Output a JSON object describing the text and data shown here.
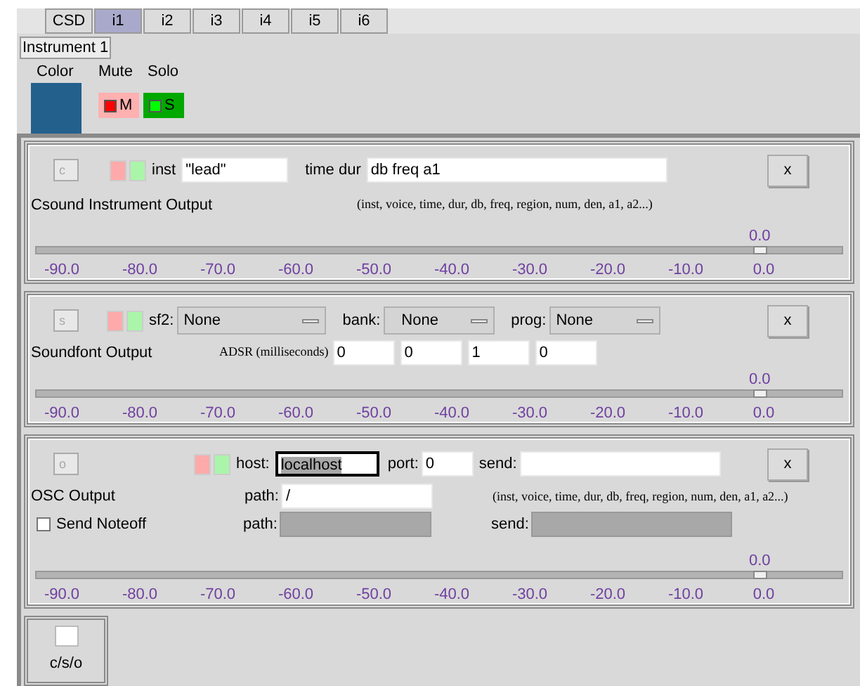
{
  "tabs": [
    {
      "label": "CSD",
      "selected": false
    },
    {
      "label": "i1",
      "selected": true
    },
    {
      "label": "i2",
      "selected": false
    },
    {
      "label": "i3",
      "selected": false
    },
    {
      "label": "i4",
      "selected": false
    },
    {
      "label": "i5",
      "selected": false
    },
    {
      "label": "i6",
      "selected": false
    }
  ],
  "instrument": {
    "name": "Instrument 1",
    "color_label": "Color",
    "mute_label": "Mute",
    "solo_label": "Solo",
    "color": "#23608c",
    "mute": {
      "label": "M",
      "on": true
    },
    "solo": {
      "label": "S",
      "on": true
    }
  },
  "modules": [
    {
      "kind": "csound",
      "letter": "c",
      "inst_label": "inst",
      "inst_value": "\"lead\"",
      "pfields_label": "time dur",
      "pfields_value": "db freq a1",
      "close": "x",
      "title": "Csound Instrument Output",
      "hint": "(inst, voice, time, dur, db, freq, region, num, den, a1, a2...)",
      "slider": {
        "reading": "0.0",
        "level": 0.89,
        "ticks": [
          "-90.0",
          "-80.0",
          "-70.0",
          "-60.0",
          "-50.0",
          "-40.0",
          "-30.0",
          "-20.0",
          "-10.0",
          "0.0"
        ]
      }
    },
    {
      "kind": "soundfont",
      "letter": "s",
      "sf2_label": "sf2:",
      "sf2_value": "None",
      "bank_label": "bank:",
      "bank_value": "None",
      "prog_label": "prog:",
      "prog_value": "None",
      "close": "x",
      "title": "Soundfont Output",
      "adsr_label": "ADSR (milliseconds)",
      "adsr": [
        "0",
        "0",
        "1",
        "0"
      ],
      "slider": {
        "reading": "0.0",
        "level": 0.89,
        "ticks": [
          "-90.0",
          "-80.0",
          "-70.0",
          "-60.0",
          "-50.0",
          "-40.0",
          "-30.0",
          "-20.0",
          "-10.0",
          "0.0"
        ]
      }
    },
    {
      "kind": "osc",
      "letter": "o",
      "host_label": "host:",
      "host_value": "localhost",
      "host_focused": true,
      "port_label": "port:",
      "port_value": "0",
      "send_label": "send:",
      "close": "x",
      "title": "OSC Output",
      "path_label": "path:",
      "path_value": "/",
      "hint": "(inst, voice, time, dur, db, freq, region, num, den, a1, a2...)",
      "noteoff": {
        "label": "Send Noteoff",
        "checked": false
      },
      "path2_label": "path:",
      "path2_disabled": true,
      "send2_label": "send:",
      "send2_disabled": true,
      "slider": {
        "reading": "0.0",
        "level": 0.89,
        "ticks": [
          "-90.0",
          "-80.0",
          "-70.0",
          "-60.0",
          "-50.0",
          "-40.0",
          "-30.0",
          "-20.0",
          "-10.0",
          "0.0"
        ]
      }
    }
  ],
  "add_button": {
    "label": "c/s/o"
  }
}
